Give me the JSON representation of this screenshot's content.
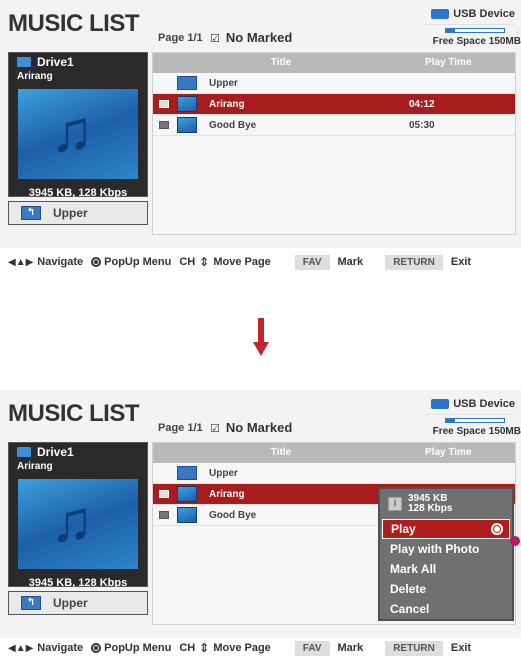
{
  "screen": {
    "title": "MUSIC LIST",
    "page_info": "Page 1/1",
    "marked": "No Marked",
    "device": "USB Device",
    "free_space": "Free Space 150MB",
    "free_space_level": 0.15
  },
  "left_panel": {
    "drive": "Drive1",
    "track": "Arirang",
    "info": "3945 KB, 128 Kbps",
    "upper": "Upper"
  },
  "list": {
    "col_title": "Title",
    "col_time": "Play Time",
    "rows": [
      {
        "name": "Upper",
        "time": ""
      },
      {
        "name": "Arirang",
        "time": "04:12"
      },
      {
        "name": "Good Bye",
        "time": "05:30"
      }
    ]
  },
  "footer": {
    "navigate": "Navigate",
    "popup_menu": "PopUp Menu",
    "ch": "CH",
    "move_page": "Move Page",
    "fav": "FAV",
    "mark": "Mark",
    "return": "RETURN",
    "exit": "Exit"
  },
  "popup": {
    "info_line1": "3945 KB",
    "info_line2": "128 Kbps",
    "items": [
      "Play",
      "Play with Photo",
      "Mark All",
      "Delete",
      "Cancel"
    ]
  },
  "colors": {
    "accent_red": "#a71c1c",
    "usb_blue": "#2b76c7",
    "popup_gray": "#707070"
  },
  "icons": [
    "usb-icon",
    "folder-up-icon",
    "music-note-icon",
    "navigate-arrows-icon",
    "ok-button-icon",
    "ch-arrows-icon",
    "down-arrow-icon",
    "radio-selected-icon"
  ]
}
